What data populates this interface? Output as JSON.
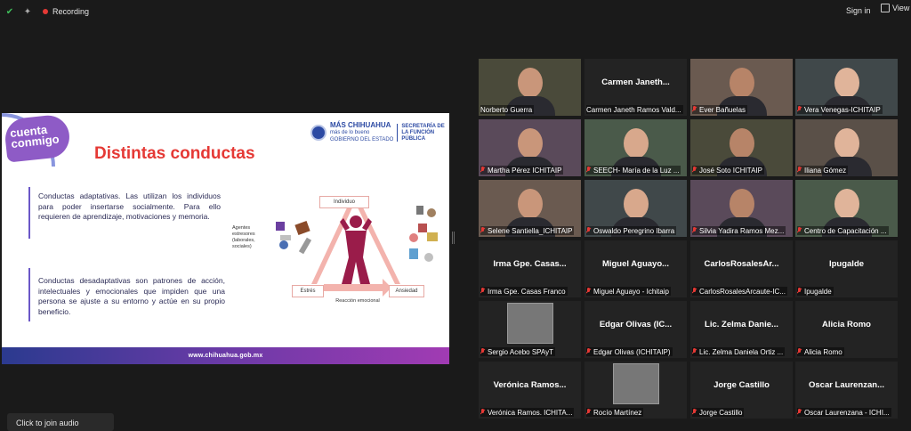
{
  "topbar": {
    "recording_label": "Recording",
    "signin_label": "Sign in",
    "view_label": "View"
  },
  "slide": {
    "logo_text": [
      "cuenta",
      "conmigo"
    ],
    "title": "Distintas conductas",
    "gov_main": "MÁS CHIHUAHUA",
    "gov_sub": "más de lo bueno",
    "gov_sub2": "GOBIERNO DEL ESTADO",
    "secretaria": "SECRETARÍA DE LA FUNCIÓN PÚBLICA",
    "paragraph1": "Conductas adaptativas. Las utilizan los individuos para poder insertarse socialmente. Para ello requieren de aprendizaje, motivaciones y memoria.",
    "paragraph2": "Conductas desadaptativas son patrones de acción, intelectuales y emocionales que impiden que una persona se ajuste a su entorno y actúe en su propio beneficio.",
    "diagram": {
      "individuo": "Individuo",
      "agentes": "Agentes estresores (laborales, sociales)",
      "estres": "Estrés",
      "ansiedad": "Ansiedad",
      "reaccion": "Reacción emocional"
    },
    "footer_url": "www.chihuahua.gob.mx"
  },
  "participants": [
    {
      "name": "Norberto Guerra",
      "label": "Norberto Guerra",
      "video": true,
      "muted": false,
      "active": true
    },
    {
      "name": "Carmen  Janeth...",
      "label": "Carmen Janeth Ramos Vald...",
      "video": false,
      "muted": false
    },
    {
      "name": "Ever Bañuelas",
      "label": "Ever Bañuelas",
      "video": true,
      "muted": true
    },
    {
      "name": "Vera Venegas-ICHITAIP",
      "label": "Vera Venegas-ICHITAIP",
      "video": true,
      "muted": true
    },
    {
      "name": "Martha Pérez ICHITAIP",
      "label": "Martha Pérez ICHITAIP",
      "video": true,
      "muted": true
    },
    {
      "name": "SEECH- María de la Luz",
      "label": "SEECH- María de la Luz ...",
      "video": true,
      "muted": true
    },
    {
      "name": "José Soto ICHITAIP",
      "label": "José Soto ICHITAIP",
      "video": true,
      "muted": true
    },
    {
      "name": "Iliana Gómez",
      "label": "Iliana Gómez",
      "video": true,
      "muted": true
    },
    {
      "name": "Selene Santiella ICHITAIP",
      "label": "Selene Santiella_ICHITAIP",
      "video": true,
      "muted": true
    },
    {
      "name": "Oswaldo Peregrino Ibarra",
      "label": "Oswaldo Peregrino Ibarra",
      "video": true,
      "muted": true
    },
    {
      "name": "Silvia Yadira Ramos Mez...",
      "label": "Silvia Yadira Ramos Mez...",
      "video": true,
      "muted": true
    },
    {
      "name": "Centro de Capacitación ...",
      "label": "Centro de Capacitación ...",
      "video": true,
      "muted": true
    },
    {
      "name": "Irma  Gpe.  Casas...",
      "label": "Irma Gpe. Casas Franco",
      "video": false,
      "muted": true
    },
    {
      "name": "Miguel  Aguayo...",
      "label": "Miguel Aguayo - Ichitaip",
      "video": false,
      "muted": true
    },
    {
      "name": "CarlosRosalesAr...",
      "label": "CarlosRosalesArcaute-IC...",
      "video": false,
      "muted": true
    },
    {
      "name": "Ipugalde",
      "label": "Ipugalde",
      "video": false,
      "muted": true
    },
    {
      "name": "Sergio Acebo SPAyT",
      "label": "Sergio Acebo SPAyT",
      "video": false,
      "muted": true,
      "avatar": true
    },
    {
      "name": "Edgar  Olivas  (IC...",
      "label": "Edgar Olivas (ICHITAIP)",
      "video": false,
      "muted": true
    },
    {
      "name": "Lic.  Zelma  Danie...",
      "label": "Lic. Zelma Daniela Ortiz ...",
      "video": false,
      "muted": true
    },
    {
      "name": "Alicia Romo",
      "label": "Alicia Romo",
      "video": false,
      "muted": true
    },
    {
      "name": "Verónica  Ramos...",
      "label": "Verónica Ramos.  ICHITA...",
      "video": false,
      "muted": true
    },
    {
      "name": "Rocío Martínez",
      "label": "Rocío Martínez",
      "video": false,
      "muted": true,
      "avatar": true
    },
    {
      "name": "Jorge Castillo",
      "label": "Jorge Castillo",
      "video": false,
      "muted": true
    },
    {
      "name": "Oscar  Laurenzan...",
      "label": "Oscar Laurenzana - ICHI...",
      "video": false,
      "muted": true
    }
  ],
  "join_audio": "Click to join audio",
  "colors": {
    "active_border": "#c6e83a",
    "mute": "#e53935",
    "slide_accent": "#e53935"
  }
}
